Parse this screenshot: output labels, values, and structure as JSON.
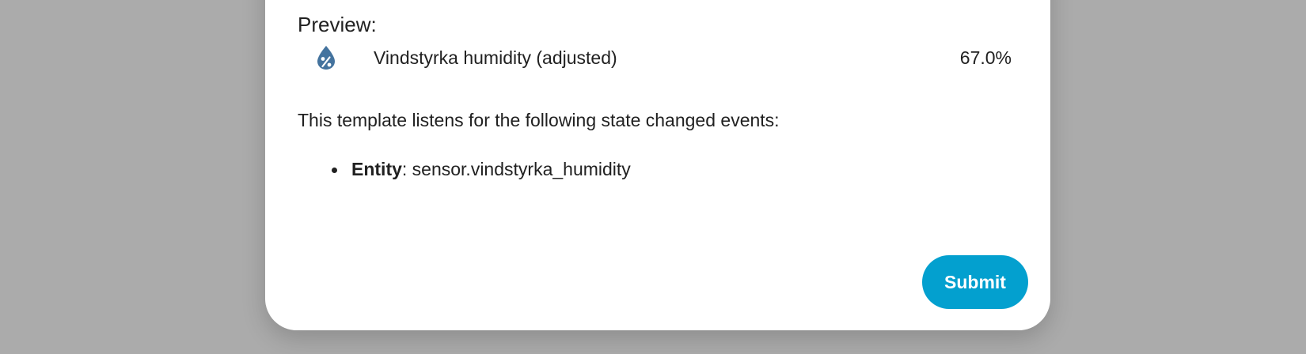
{
  "preview": {
    "label": "Preview:"
  },
  "entity": {
    "icon": "water-percent-icon",
    "icon_color": "#44739e",
    "name": "Vindstyrka humidity (adjusted)",
    "state": "67.0%"
  },
  "listeners": {
    "intro": "This template listens for the following state changed events:",
    "items": [
      {
        "key": "Entity",
        "separator": ": ",
        "value": "sensor.vindstyrka_humidity"
      }
    ]
  },
  "actions": {
    "submit_label": "Submit",
    "submit_color": "#03a0cf"
  }
}
